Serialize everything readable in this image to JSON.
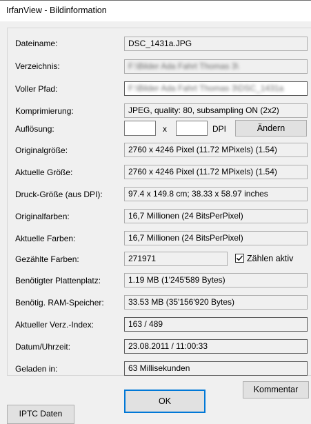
{
  "window": {
    "title": "IrfanView - Bildinformation"
  },
  "fields": [
    {
      "id": "dateiname",
      "label": "Dateiname:",
      "value": "DSC_1431a.JPG"
    },
    {
      "id": "verzeichnis",
      "label": "Verzeichnis:",
      "value": "F:\\Bilder Ada Fahrt Thomas 3\\"
    },
    {
      "id": "voller-pfad",
      "label": "Voller Pfad:",
      "value": "F:\\Bilder Ada Fahrt Thomas 3\\DSC_1431a"
    },
    {
      "id": "komprimierung",
      "label": "Komprimierung:",
      "value": "JPEG, quality: 80, subsampling ON (2x2)"
    },
    {
      "id": "originalgroesse",
      "label": "Originalgröße:",
      "value": "2760 x 4246  Pixel (11.72 MPixels) (1.54)"
    },
    {
      "id": "aktuelle-groesse",
      "label": "Aktuelle Größe:",
      "value": "2760 x 4246  Pixel (11.72 MPixels) (1.54)"
    },
    {
      "id": "druck-groesse",
      "label": "Druck-Größe (aus DPI):",
      "value": "97.4 x 149.8 cm; 38.33 x 58.97 inches"
    },
    {
      "id": "originalfarben",
      "label": "Originalfarben:",
      "value": "16,7 Millionen   (24 BitsPerPixel)"
    },
    {
      "id": "aktuelle-farben",
      "label": "Aktuelle Farben:",
      "value": "16,7 Millionen   (24 BitsPerPixel)"
    },
    {
      "id": "plattenplatz",
      "label": "Benötigter Plattenplatz:",
      "value": "1.19 MB (1'245'589 Bytes)"
    },
    {
      "id": "ram-speicher",
      "label": "Benötig. RAM-Speicher:",
      "value": "33.53  MB (35'156'920 Bytes)"
    },
    {
      "id": "verz-index",
      "label": "Aktueller Verz.-Index:",
      "value": "163  /  489"
    },
    {
      "id": "datum",
      "label": "Datum/Uhrzeit:",
      "value": "23.08.2011 / 11:00:33"
    },
    {
      "id": "geladen",
      "label": "Geladen in:",
      "value": "63 Millisekunden"
    }
  ],
  "aufloesung": {
    "label": "Auflösung:",
    "x_value": "",
    "y_value": "",
    "separator": "x",
    "unit": "DPI",
    "change_button": "Ändern"
  },
  "gezaehlte_farben": {
    "label": "Gezählte Farben:",
    "value": "271971",
    "checkbox_label": "Zählen aktiv",
    "checked": true
  },
  "buttons": {
    "kommentar": "Kommentar",
    "ok": "OK",
    "iptc": "IPTC Daten"
  }
}
